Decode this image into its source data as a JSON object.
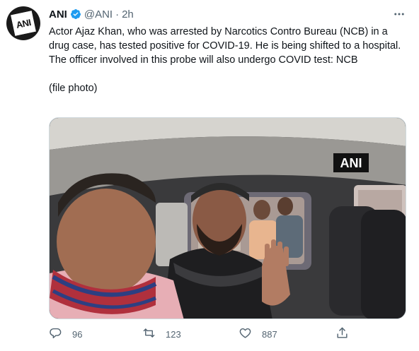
{
  "tweet": {
    "name": "ANI",
    "handle": "@ANI",
    "separator": "·",
    "time": "2h",
    "text": "Actor Ajaz Khan, who was arrested by Narcotics Contro Bureau (NCB) in a drug case, has tested positive for COVID-19. He is being shifted to a hospital. The officer involved in this probe will also undergo COVID test: NCB\n\n(file photo)",
    "watermark": "ANI",
    "avatar_logo": "ANI"
  },
  "actions": {
    "replies": "96",
    "retweets": "123",
    "likes": "887"
  },
  "colors": {
    "verified": "#1d9bf0",
    "secondary": "#536471",
    "primary_text": "#0f1419"
  },
  "icons": [
    "verified-badge-icon",
    "more-icon",
    "reply-icon",
    "retweet-icon",
    "like-icon",
    "share-icon"
  ]
}
